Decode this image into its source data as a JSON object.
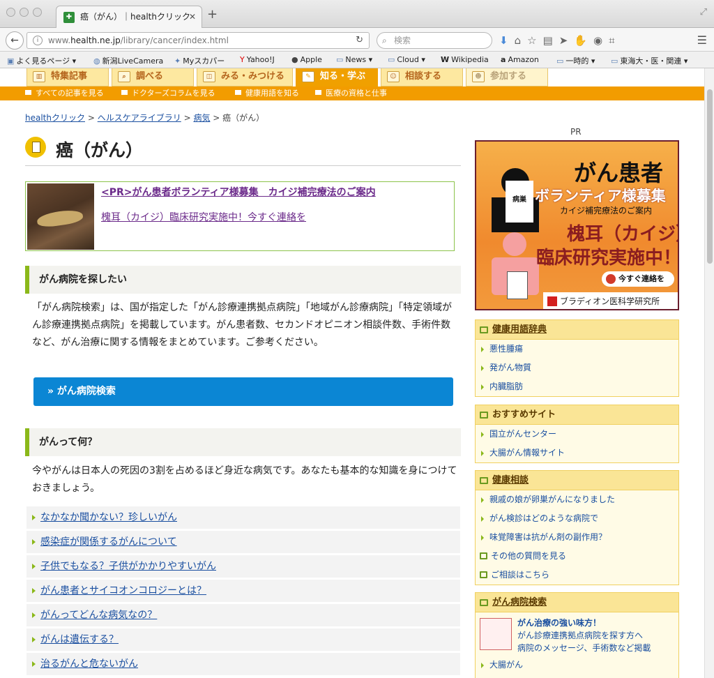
{
  "browser": {
    "tab_title": "癌（がん）｜healthクリック",
    "url_prefix": "www.",
    "url_host": "health.ne.jp",
    "url_path": "/library/cancer/index.html",
    "search_placeholder": "検索"
  },
  "bookmarks": [
    "よく見るページ ▾",
    "新潟LiveCamera",
    "Myスカパー",
    "Yahoo!J",
    "Apple",
    "News ▾",
    "Cloud ▾",
    "Wikipedia",
    "Amazon",
    "一時的 ▾",
    "東海大・医・関連 ▾"
  ],
  "global_nav": [
    "特集記事",
    "調べる",
    "みる・みつける",
    "知る・学ぶ",
    "相談する",
    "参加する"
  ],
  "sub_nav": [
    "すべての記事を見る",
    "ドクターズコラムを見る",
    "健康用語を知る",
    "医療の資格と仕事"
  ],
  "breadcrumb": {
    "home": "healthクリック",
    "sep": ">",
    "library": "ヘルスケアライブラリ",
    "disease": "病気",
    "current": "> 癌（がん）"
  },
  "page_title": "癌（がん）",
  "promo": {
    "title": "<PR>がん患者ボランティア様募集　カイジ補完療法のご案内",
    "text": "槐耳（カイジ）臨床研究実施中！今すぐ連絡を"
  },
  "section1": {
    "heading": "がん病院を探したい",
    "text": "「がん病院検索」は、国が指定した「がん診療連携拠点病院」「地域がん診療病院」「特定領域がん診療連携拠点病院」を掲載しています。がん患者数、セカンドオピニオン相談件数、手術件数など、がん治療に関する情報をまとめています。ご参考ください。",
    "button": "» がん病院検索"
  },
  "section2": {
    "heading": "がんって何？",
    "text": "今やがんは日本人の死因の3割を占めるほど身近な病気です。あなたも基本的な知識を身につけておきましょう。",
    "links": [
      "なかなか聞かない？珍しいがん",
      "感染症が関係するがんについて",
      "子供でもなる？子供がかかりやすいがん",
      "がん患者とサイコオンコロジーとは？",
      "がんってどんな病気なの？",
      "がんは遺伝する？",
      "治るがんと危ないがん"
    ]
  },
  "ad": {
    "pr_label": "PR",
    "line1": "がん患者",
    "line2": "ボランティア様募集",
    "line3": "カイジ補完療法のご案内",
    "line4": "槐耳（カイジ）",
    "line5": "臨床研究実施中！",
    "badge": "病巣",
    "cta": "今すぐ連絡を",
    "company": "ブラディオン医科学研究所"
  },
  "sidebar": {
    "glossary": {
      "title": "健康用語辞典",
      "items": [
        "悪性腫瘍",
        "発がん物質",
        "内臓脂肪"
      ]
    },
    "recommended": {
      "title": "おすすめサイト",
      "items": [
        "国立がんセンター",
        "大腸がん情報サイト"
      ]
    },
    "consult": {
      "title": "健康相談",
      "items": [
        "親戚の娘が卵巣がんになりました",
        "がん検診はどのような病院で",
        "味覚障害は抗がん剤の副作用？"
      ],
      "more": "その他の質問を見る",
      "ask": "ご相談はこちら"
    },
    "hospital": {
      "title": "がん病院検索",
      "feat_title": "がん治療の強い味方！",
      "feat_text1": "がん診療連携拠点病院を探す方へ",
      "feat_text2": "病院のメッセージ、手術数など掲載",
      "items": [
        "大腸がん"
      ]
    }
  }
}
